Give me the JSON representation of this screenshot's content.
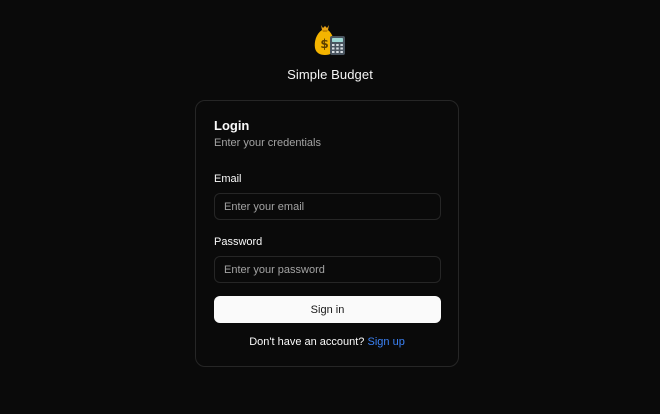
{
  "app": {
    "title": "Simple Budget",
    "logo_icon": "money-bag-calculator-icon"
  },
  "login": {
    "title": "Login",
    "subtitle": "Enter your credentials",
    "email_label": "Email",
    "email_placeholder": "Enter your email",
    "email_value": "",
    "password_label": "Password",
    "password_placeholder": "Enter your password",
    "password_value": "",
    "submit_label": "Sign in",
    "signup_prompt": "Don't have an account?",
    "signup_link": "Sign up"
  },
  "colors": {
    "background": "#0a0a0a",
    "border": "#262626",
    "button": "#fafafa",
    "link": "#3b82f6",
    "muted_text": "#a3a3a3"
  }
}
